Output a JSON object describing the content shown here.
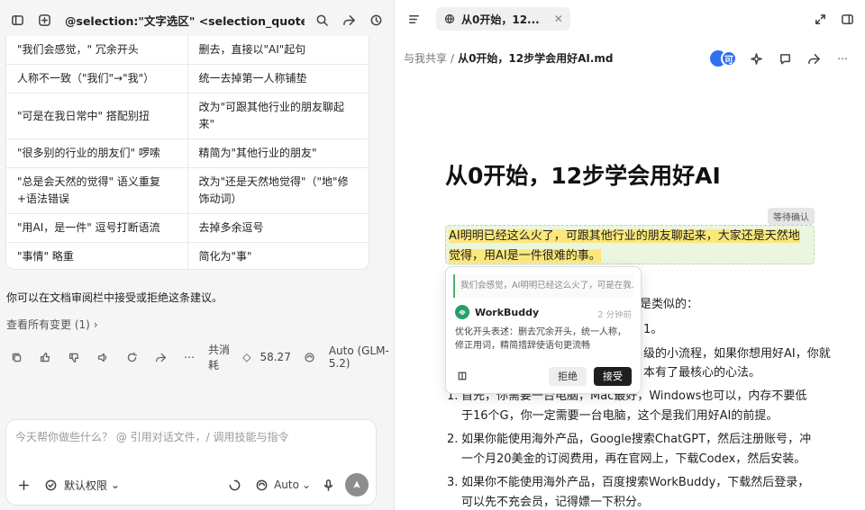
{
  "left_panel": {
    "title": "@selection:\"文字选区\" <selection_quote sourc...",
    "table_rows": [
      {
        "issue": "\"我们会感觉，\" 冗余开头",
        "fix": "删去，直接以\"AI\"起句"
      },
      {
        "issue": "人称不一致（\"我们\"→\"我\"）",
        "fix": "统一去掉第一人称铺垫"
      },
      {
        "issue": "\"可是在我日常中\" 搭配别扭",
        "fix": "改为\"可跟其他行业的朋友聊起来\""
      },
      {
        "issue": "\"很多别的行业的朋友们\" 啰嗦",
        "fix": "精简为\"其他行业的朋友\""
      },
      {
        "issue": "\"总是会天然的觉得\" 语义重复+语法错误",
        "fix": "改为\"还是天然地觉得\"（\"地\"修饰动词）"
      },
      {
        "issue": "\"用AI，是一件\" 逗号打断语流",
        "fix": "去掉多余逗号"
      },
      {
        "issue": "\"事情\" 略重",
        "fix": "简化为\"事\""
      }
    ],
    "note": "你可以在文档审阅栏中接受或拒绝这条建议。",
    "view_changes": "查看所有变更 (1)",
    "consumption_label": "共消耗",
    "consumption_value": "58.27",
    "model_info": "Auto (GLM-5.2)",
    "composer_placeholder": "今天帮你做些什么？ @ 引用对话文件，/ 调用技能与指令",
    "permission_label": "默认权限",
    "model_select": "Auto"
  },
  "right_panel": {
    "tab_label": "从0开始，12...",
    "breadcrumb_parent": "与我共享",
    "breadcrumb_separator": "/",
    "breadcrumb_current": "从0开始，12步学会用好AI.md",
    "avatar_letter": "可",
    "doc_title": "从0开始，12步学会用好AI",
    "pending_badge": "等待确认",
    "highlighted_text": "AI明明已经这么火了，可跟其他行业的朋友聊起来，大家还是天然地觉得，用AI是一件很难的事。",
    "line_a": "是类似的：",
    "line_b": "1。",
    "line_c": "级的小流程，如果你想用好AI，你就",
    "line_d": "本有了最核心的心法。",
    "steps": [
      {
        "num": "1.",
        "text": "首先，你需要一台电脑，Mac最好，Windows也可以，内存不要低于16个G，你一定需要一台电脑，这个是我们用好AI的前提。"
      },
      {
        "num": "2.",
        "text": "如果你能使用海外产品，Google搜索ChatGPT，然后注册账号，冲一个月20美金的订阅费用，再在官网上，下载Codex，然后安装。"
      },
      {
        "num": "3.",
        "text": "如果你不能使用海外产品，百度搜索WorkBuddy，下载然后登录，可以先不充会员，记得嫖一下积分。"
      }
    ],
    "popup": {
      "quote": "我们会感觉，AI明明已经这么火了，可是在我...",
      "author": "WorkBuddy",
      "time": "2 分钟前",
      "body": "优化开头表述：删去冗余开头，统一人称，修正用词，精简措辞使语句更流畅",
      "reject_label": "拒绝",
      "accept_label": "接受"
    }
  },
  "colors": {
    "highlight": "#fbe77a",
    "accent_green": "#22a06b",
    "avatar_blue": "#2f6ff0"
  }
}
